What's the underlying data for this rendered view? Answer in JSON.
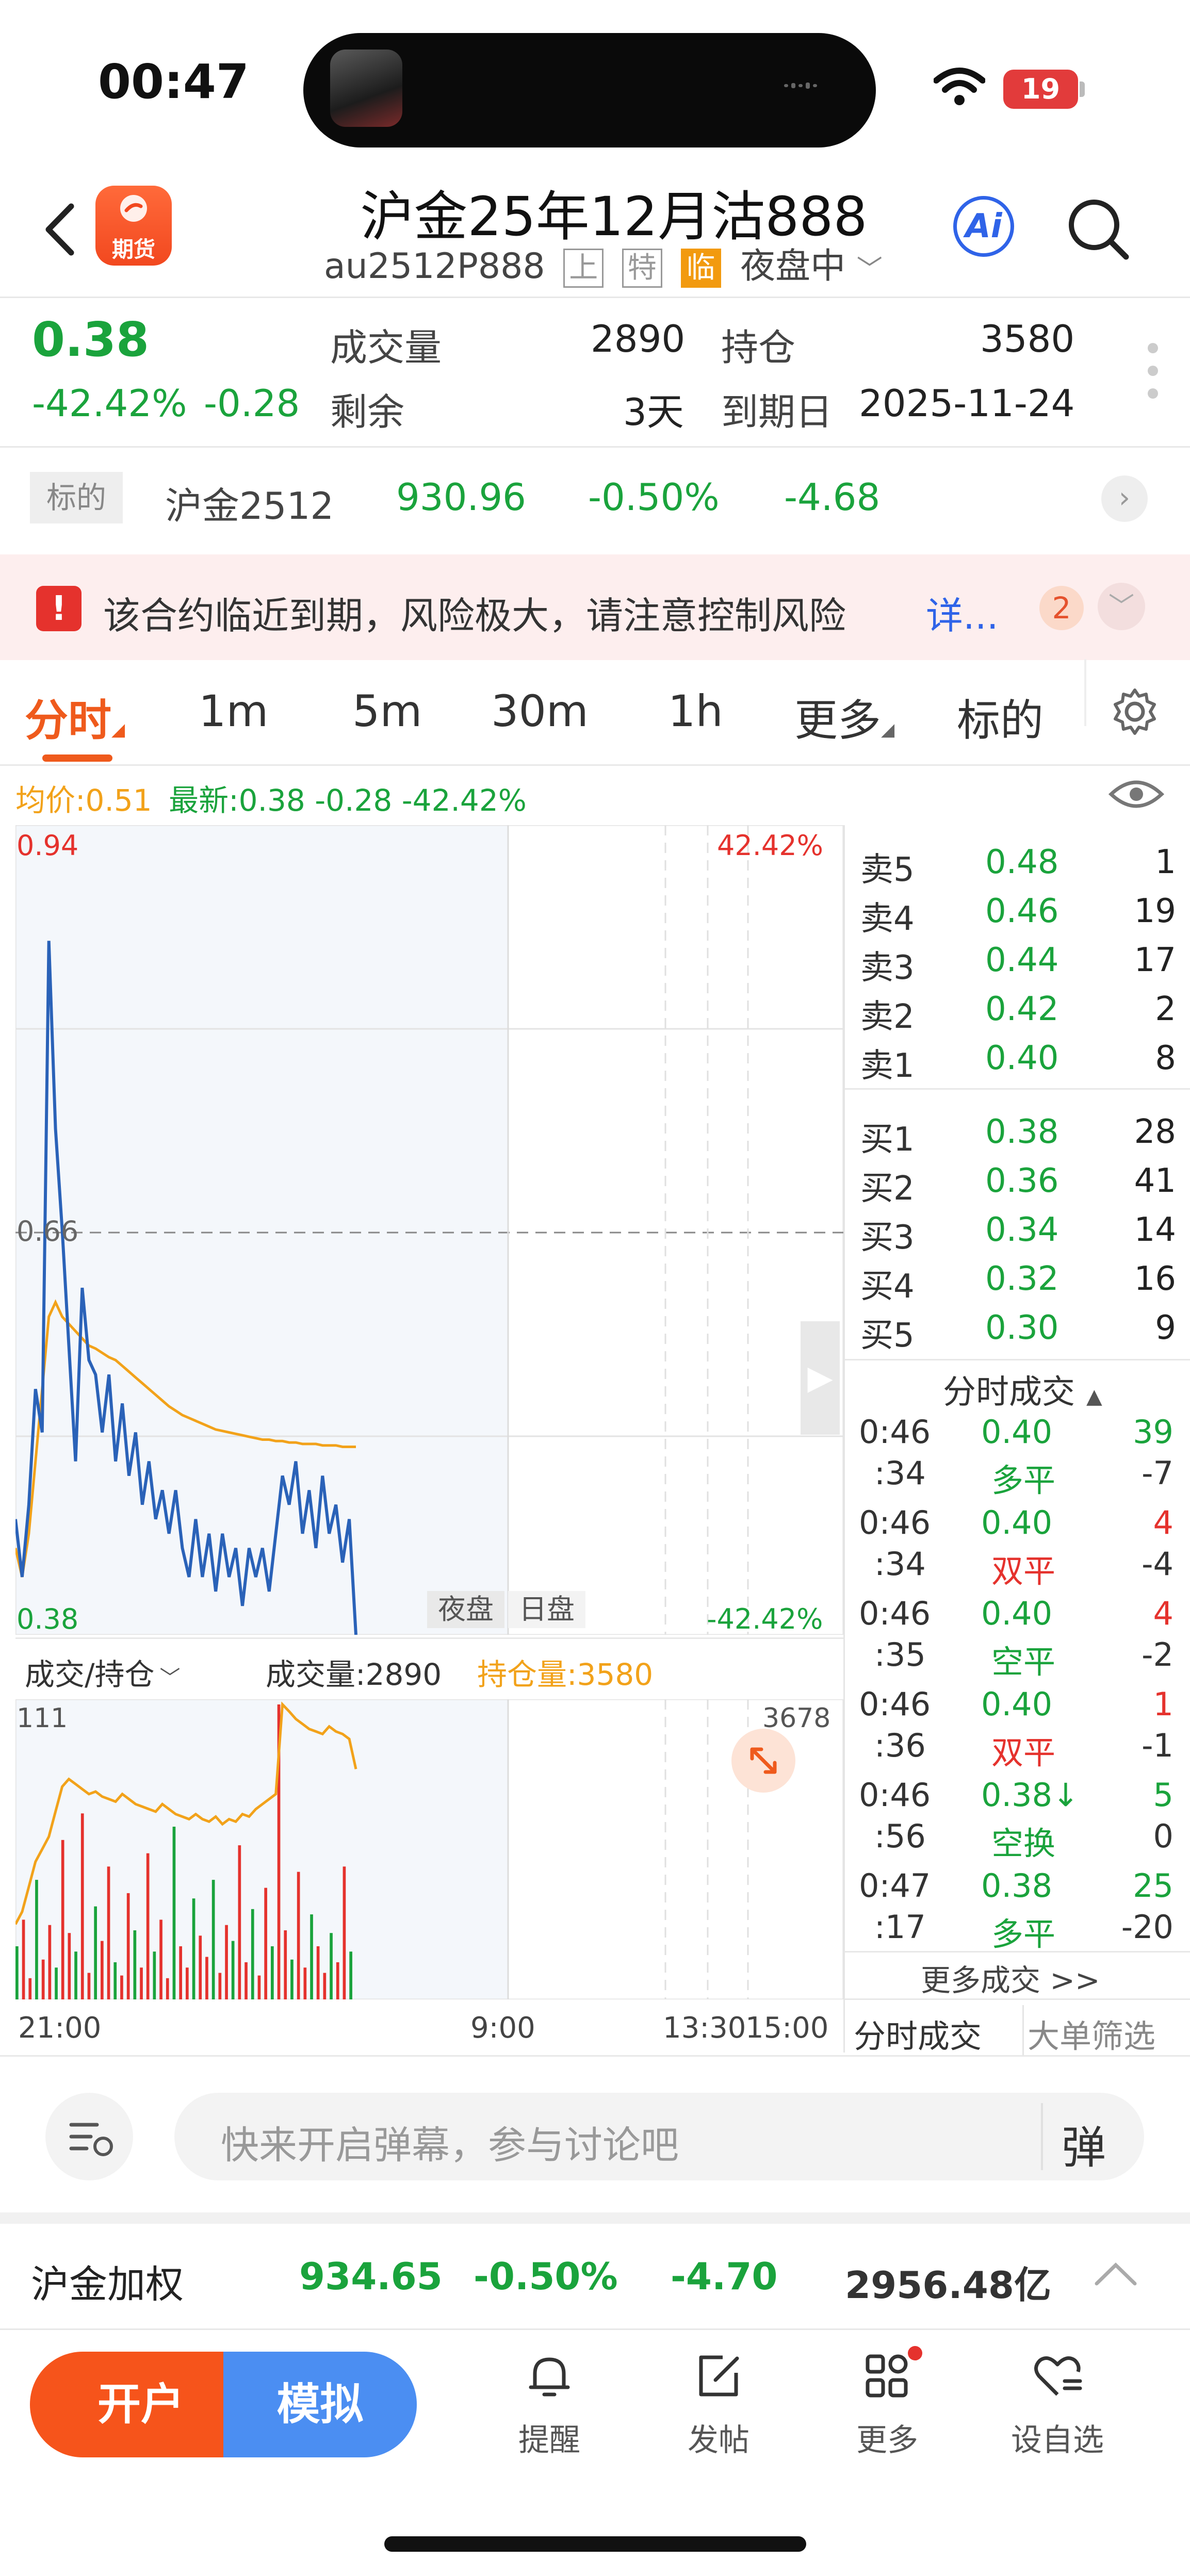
{
  "status": {
    "time": "00:47",
    "battery": "19"
  },
  "header": {
    "title": "沪金25年12月沽888",
    "code": "au2512P888",
    "tags": [
      "上",
      "特",
      "临"
    ],
    "session": "夜盘中",
    "logo_text": "期货",
    "ai_label": "Ai"
  },
  "quote": {
    "price": "0.38",
    "change_pct": "-42.42%",
    "change": "-0.28",
    "volume_label": "成交量",
    "volume": "2890",
    "oi_label": "持仓",
    "oi": "3580",
    "remain_label": "剩余",
    "remain": "3天",
    "expiry_label": "到期日",
    "expiry": "2025-11-24"
  },
  "underlying": {
    "tag": "标的",
    "name": "沪金2512",
    "price": "930.96",
    "pct": "-0.50%",
    "change": "-4.68"
  },
  "warning": {
    "text": "该合约临近到期，风险极大，请注意控制风险",
    "link": "详...",
    "count": "2"
  },
  "tabs": [
    "分时",
    "1m",
    "5m",
    "30m",
    "1h",
    "更多",
    "标的"
  ],
  "chart_meta": {
    "avg_label": "均价:0.51",
    "latest_label": "最新:0.38 -0.28 -42.42%",
    "y_top": "0.94",
    "y_mid": "0.66",
    "y_bottom": "0.38",
    "pct_top": "42.42%",
    "pct_bottom": "-42.42%",
    "session_night": "夜盘",
    "session_day": "日盘",
    "vol_selector": "成交/持仓",
    "vol_label": "成交量:2890",
    "oi_vol_label": "持仓量:3580",
    "vol_max": "111",
    "oi_max": "3678",
    "x_ticks": [
      "21:00",
      "9:00",
      "13:30",
      "15:00"
    ]
  },
  "chart_data": [
    {
      "type": "line",
      "title": "",
      "xlabel": "",
      "ylabel": "",
      "ylim": [
        0.38,
        0.94
      ],
      "series": [
        {
          "name": "",
          "values": [
            0.46,
            0.42,
            0.47,
            0.55,
            0.52,
            0.86,
            0.73,
            0.66,
            0.58,
            0.5,
            0.62,
            0.57,
            0.56,
            0.52,
            0.56,
            0.5,
            0.54,
            0.49,
            0.52,
            0.47,
            0.5,
            0.46,
            0.48,
            0.45,
            0.48,
            0.44,
            0.42,
            0.46,
            0.42,
            0.45,
            0.41,
            0.45,
            0.42,
            0.44,
            0.4,
            0.44,
            0.42,
            0.44,
            0.41,
            0.45,
            0.49,
            0.47,
            0.5,
            0.45,
            0.48,
            0.44,
            0.49,
            0.45,
            0.47,
            0.43,
            0.46,
            0.38
          ]
        },
        {
          "name": "",
          "values": [
            0.44,
            0.42,
            0.45,
            0.5,
            0.55,
            0.6,
            0.61,
            0.6,
            0.595,
            0.59,
            0.585,
            0.58,
            0.578,
            0.575,
            0.572,
            0.57,
            0.566,
            0.562,
            0.558,
            0.554,
            0.55,
            0.546,
            0.542,
            0.538,
            0.535,
            0.532,
            0.53,
            0.528,
            0.526,
            0.524,
            0.522,
            0.521,
            0.52,
            0.519,
            0.518,
            0.517,
            0.516,
            0.515,
            0.515,
            0.514,
            0.514,
            0.513,
            0.513,
            0.512,
            0.512,
            0.512,
            0.511,
            0.511,
            0.511,
            0.51,
            0.51,
            0.51
          ]
        }
      ]
    },
    {
      "type": "bar",
      "title": "",
      "ylim": [
        0,
        111
      ],
      "series": [
        {
          "name": "",
          "values": [
            20,
            30,
            8,
            45,
            15,
            28,
            12,
            60,
            25,
            18,
            70,
            10,
            35,
            22,
            50,
            14,
            9,
            40,
            26,
            12,
            55,
            18,
            30,
            8,
            65,
            20,
            12,
            38,
            24,
            16,
            45,
            10,
            28,
            22,
            58,
            14,
            34,
            9,
            42,
            20,
            111,
            26,
            15,
            48,
            12,
            32,
            20,
            10,
            25,
            14,
            50,
            18
          ]
        },
        {
          "name": "",
          "values": [
            2800,
            2850,
            2950,
            3050,
            3100,
            3150,
            3250,
            3350,
            3380,
            3360,
            3340,
            3320,
            3330,
            3310,
            3300,
            3290,
            3320,
            3300,
            3280,
            3270,
            3260,
            3250,
            3280,
            3260,
            3240,
            3230,
            3220,
            3240,
            3220,
            3210,
            3230,
            3200,
            3220,
            3210,
            3240,
            3230,
            3260,
            3280,
            3300,
            3320,
            3678,
            3650,
            3620,
            3600,
            3580,
            3570,
            3560,
            3590,
            3570,
            3560,
            3540,
            3420
          ]
        }
      ]
    }
  ],
  "orderbook": {
    "asks": [
      {
        "label": "卖5",
        "price": "0.48",
        "vol": "1"
      },
      {
        "label": "卖4",
        "price": "0.46",
        "vol": "19"
      },
      {
        "label": "卖3",
        "price": "0.44",
        "vol": "17"
      },
      {
        "label": "卖2",
        "price": "0.42",
        "vol": "2"
      },
      {
        "label": "卖1",
        "price": "0.40",
        "vol": "8"
      }
    ],
    "bids": [
      {
        "label": "买1",
        "price": "0.38",
        "vol": "28"
      },
      {
        "label": "买2",
        "price": "0.36",
        "vol": "41"
      },
      {
        "label": "买3",
        "price": "0.34",
        "vol": "14"
      },
      {
        "label": "买4",
        "price": "0.32",
        "vol": "16"
      },
      {
        "label": "买5",
        "price": "0.30",
        "vol": "9"
      }
    ]
  },
  "ticks_title": "分时成交",
  "ticks": [
    {
      "t1": "0:46",
      "t2": ":34",
      "price": "0.40",
      "type": "多平",
      "vol": "39",
      "delta": "-7"
    },
    {
      "t1": "0:46",
      "t2": ":34",
      "price": "0.40",
      "type": "双平",
      "vol": "4",
      "delta": "-4"
    },
    {
      "t1": "0:46",
      "t2": ":35",
      "price": "0.40",
      "type": "空平",
      "vol": "4",
      "delta": "-2"
    },
    {
      "t1": "0:46",
      "t2": ":36",
      "price": "0.40",
      "type": "双平",
      "vol": "1",
      "delta": "-1"
    },
    {
      "t1": "0:46",
      "t2": ":56",
      "price": "0.38↓",
      "type": "空换",
      "vol": "5",
      "delta": "0"
    },
    {
      "t1": "0:47",
      "t2": ":17",
      "price": "0.38",
      "type": "多平",
      "vol": "25",
      "delta": "-20"
    }
  ],
  "more_ticks": "更多成交 >>",
  "side_tabs": [
    "分时成交",
    "大单筛选"
  ],
  "comment_placeholder": "快来开启弹幕，参与讨论吧",
  "danmu_label": "弹",
  "index_bar": {
    "name": "沪金加权",
    "price": "934.65",
    "pct": "-0.50%",
    "change": "-4.70",
    "turnover": "2956.48亿"
  },
  "bottom": {
    "open": "开户",
    "sim": "模拟",
    "items": [
      "提醒",
      "发帖",
      "更多",
      "设自选"
    ]
  }
}
